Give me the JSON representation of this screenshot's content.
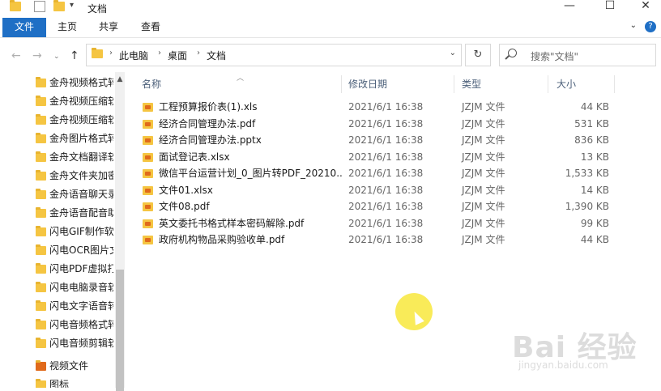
{
  "titlebar": {
    "title": "文档",
    "minimize": "—",
    "maximize": "☐",
    "close": "✕"
  },
  "ribbon": {
    "tabs": [
      {
        "label": "文件"
      },
      {
        "label": "主页"
      },
      {
        "label": "共享"
      },
      {
        "label": "查看"
      }
    ],
    "help": "?"
  },
  "address": {
    "crumbs": [
      "此电脑",
      "桌面",
      "文档"
    ],
    "search_placeholder": "搜索\"文档\""
  },
  "sidebar": {
    "items": [
      {
        "label": "金舟视频格式转"
      },
      {
        "label": "金舟视频压缩软"
      },
      {
        "label": "金舟视频压缩软"
      },
      {
        "label": "金舟图片格式转"
      },
      {
        "label": "金舟文档翻译软"
      },
      {
        "label": "金舟文件夹加密"
      },
      {
        "label": "金舟语音聊天录"
      },
      {
        "label": "金舟语音配音助"
      },
      {
        "label": "闪电GIF制作软"
      },
      {
        "label": "闪电OCR图片文"
      },
      {
        "label": "闪电PDF虚拟打"
      },
      {
        "label": "闪电电脑录音软"
      },
      {
        "label": "闪电文字语音转"
      },
      {
        "label": "闪电音频格式转"
      },
      {
        "label": "闪电音频剪辑软"
      },
      {
        "label": "视频文件"
      },
      {
        "label": "图标"
      }
    ]
  },
  "columns": {
    "name": "名称",
    "date": "修改日期",
    "type": "类型",
    "size": "大小"
  },
  "files": [
    {
      "name": "工程预算报价表(1).xls",
      "date": "2021/6/1 16:38",
      "type": "JZJM 文件",
      "size": "44 KB"
    },
    {
      "name": "经济合同管理办法.pdf",
      "date": "2021/6/1 16:38",
      "type": "JZJM 文件",
      "size": "531 KB"
    },
    {
      "name": "经济合同管理办法.pptx",
      "date": "2021/6/1 16:38",
      "type": "JZJM 文件",
      "size": "836 KB"
    },
    {
      "name": "面试登记表.xlsx",
      "date": "2021/6/1 16:38",
      "type": "JZJM 文件",
      "size": "13 KB"
    },
    {
      "name": "微信平台运营计划_0_图片转PDF_20210...",
      "date": "2021/6/1 16:38",
      "type": "JZJM 文件",
      "size": "1,533 KB"
    },
    {
      "name": "文件01.xlsx",
      "date": "2021/6/1 16:38",
      "type": "JZJM 文件",
      "size": "14 KB"
    },
    {
      "name": "文件08.pdf",
      "date": "2021/6/1 16:38",
      "type": "JZJM 文件",
      "size": "1,390 KB"
    },
    {
      "name": "英文委托书格式样本密码解除.pdf",
      "date": "2021/6/1 16:38",
      "type": "JZJM 文件",
      "size": "99 KB"
    },
    {
      "name": "政府机构物品采购验收单.pdf",
      "date": "2021/6/1 16:38",
      "type": "JZJM 文件",
      "size": "44 KB"
    }
  ],
  "watermark": {
    "main": "Bai 经验",
    "sub": "jingyan.baidu.com"
  },
  "colors": {
    "accent": "#1f6fc5",
    "folder": "#f5c542",
    "header_text": "#4c607a"
  }
}
